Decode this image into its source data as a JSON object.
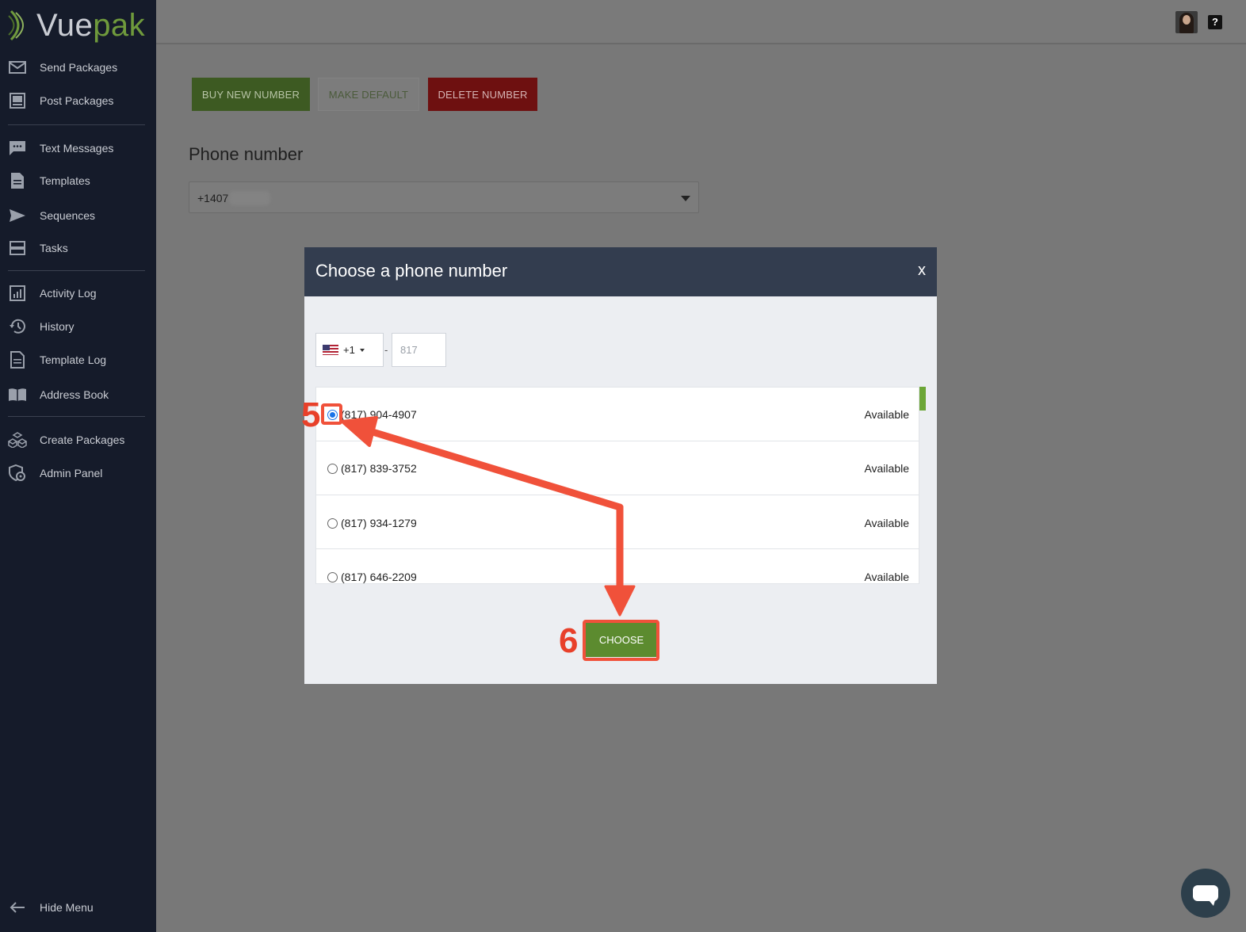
{
  "app": {
    "logo_part1": "Vue",
    "logo_part2": "pak"
  },
  "sidebar": {
    "items": [
      {
        "label": "Send Packages",
        "icon": "envelope-icon"
      },
      {
        "label": "Post Packages",
        "icon": "post-icon"
      },
      {
        "label": "Text Messages",
        "icon": "chat-icon"
      },
      {
        "label": "Templates",
        "icon": "document-icon"
      },
      {
        "label": "Sequences",
        "icon": "send-icon"
      },
      {
        "label": "Tasks",
        "icon": "tasks-icon"
      },
      {
        "label": "Activity Log",
        "icon": "chart-icon"
      },
      {
        "label": "History",
        "icon": "history-icon"
      },
      {
        "label": "Template Log",
        "icon": "document-icon"
      },
      {
        "label": "Address Book",
        "icon": "book-icon"
      },
      {
        "label": "Create Packages",
        "icon": "boxes-icon"
      },
      {
        "label": "Admin Panel",
        "icon": "admin-icon"
      }
    ],
    "hide_menu": "Hide Menu"
  },
  "topbar": {
    "help_label": "?"
  },
  "toolbar": {
    "buy_label": "BUY NEW NUMBER",
    "default_label": "MAKE DEFAULT",
    "delete_label": "DELETE NUMBER"
  },
  "phone": {
    "title": "Phone number",
    "selected_value": "+1407"
  },
  "modal": {
    "title": "Choose a phone number",
    "close_label": "x",
    "country_code": "+1",
    "dash": "-",
    "area_placeholder": "817",
    "numbers": [
      {
        "number": "(817) 904-4907",
        "status": "Available",
        "selected": true
      },
      {
        "number": "(817) 839-3752",
        "status": "Available",
        "selected": false
      },
      {
        "number": "(817) 934-1279",
        "status": "Available",
        "selected": false
      },
      {
        "number": "(817) 646-2209",
        "status": "Available",
        "selected": false
      }
    ],
    "choose_label": "CHOOSE"
  },
  "annotations": {
    "step5": "5",
    "step6": "6"
  },
  "colors": {
    "sidebar_bg": "#151b2a",
    "accent_green": "#5c8b2f",
    "danger_red": "#6e1010",
    "modal_header": "#333d4f",
    "annotation_red": "#f0513a"
  }
}
